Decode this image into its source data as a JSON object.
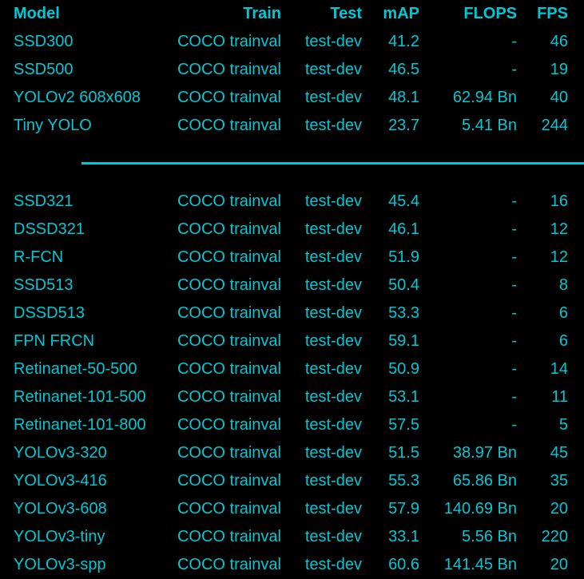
{
  "headers": {
    "model": "Model",
    "train": "Train",
    "test": "Test",
    "map": "mAP",
    "flops": "FLOPS",
    "fps": "FPS"
  },
  "group1": [
    {
      "model": "SSD300",
      "train": "COCO trainval",
      "test": "test-dev",
      "map": "41.2",
      "flops": "-",
      "fps": "46"
    },
    {
      "model": "SSD500",
      "train": "COCO trainval",
      "test": "test-dev",
      "map": "46.5",
      "flops": "-",
      "fps": "19"
    },
    {
      "model": "YOLOv2 608x608",
      "train": "COCO trainval",
      "test": "test-dev",
      "map": "48.1",
      "flops": "62.94 Bn",
      "fps": "40"
    },
    {
      "model": "Tiny YOLO",
      "train": "COCO trainval",
      "test": "test-dev",
      "map": "23.7",
      "flops": "5.41 Bn",
      "fps": "244"
    }
  ],
  "group2": [
    {
      "model": "SSD321",
      "train": "COCO trainval",
      "test": "test-dev",
      "map": "45.4",
      "flops": "-",
      "fps": "16"
    },
    {
      "model": "DSSD321",
      "train": "COCO trainval",
      "test": "test-dev",
      "map": "46.1",
      "flops": "-",
      "fps": "12"
    },
    {
      "model": "R-FCN",
      "train": "COCO trainval",
      "test": "test-dev",
      "map": "51.9",
      "flops": "-",
      "fps": "12"
    },
    {
      "model": "SSD513",
      "train": "COCO trainval",
      "test": "test-dev",
      "map": "50.4",
      "flops": "-",
      "fps": "8"
    },
    {
      "model": "DSSD513",
      "train": "COCO trainval",
      "test": "test-dev",
      "map": "53.3",
      "flops": "-",
      "fps": "6"
    },
    {
      "model": "FPN FRCN",
      "train": "COCO trainval",
      "test": "test-dev",
      "map": "59.1",
      "flops": "-",
      "fps": "6"
    },
    {
      "model": "Retinanet-50-500",
      "train": "COCO trainval",
      "test": "test-dev",
      "map": "50.9",
      "flops": "-",
      "fps": "14"
    },
    {
      "model": "Retinanet-101-500",
      "train": "COCO trainval",
      "test": "test-dev",
      "map": "53.1",
      "flops": "-",
      "fps": "11"
    },
    {
      "model": "Retinanet-101-800",
      "train": "COCO trainval",
      "test": "test-dev",
      "map": "57.5",
      "flops": "-",
      "fps": "5"
    },
    {
      "model": "YOLOv3-320",
      "train": "COCO trainval",
      "test": "test-dev",
      "map": "51.5",
      "flops": "38.97 Bn",
      "fps": "45"
    },
    {
      "model": "YOLOv3-416",
      "train": "COCO trainval",
      "test": "test-dev",
      "map": "55.3",
      "flops": "65.86 Bn",
      "fps": "35"
    },
    {
      "model": "YOLOv3-608",
      "train": "COCO trainval",
      "test": "test-dev",
      "map": "57.9",
      "flops": "140.69 Bn",
      "fps": "20"
    },
    {
      "model": "YOLOv3-tiny",
      "train": "COCO trainval",
      "test": "test-dev",
      "map": "33.1",
      "flops": "5.56 Bn",
      "fps": "220"
    },
    {
      "model": "YOLOv3-spp",
      "train": "COCO trainval",
      "test": "test-dev",
      "map": "60.6",
      "flops": "141.45 Bn",
      "fps": "20"
    }
  ],
  "colors": {
    "background": "#000000",
    "text": "#00c8d4"
  }
}
